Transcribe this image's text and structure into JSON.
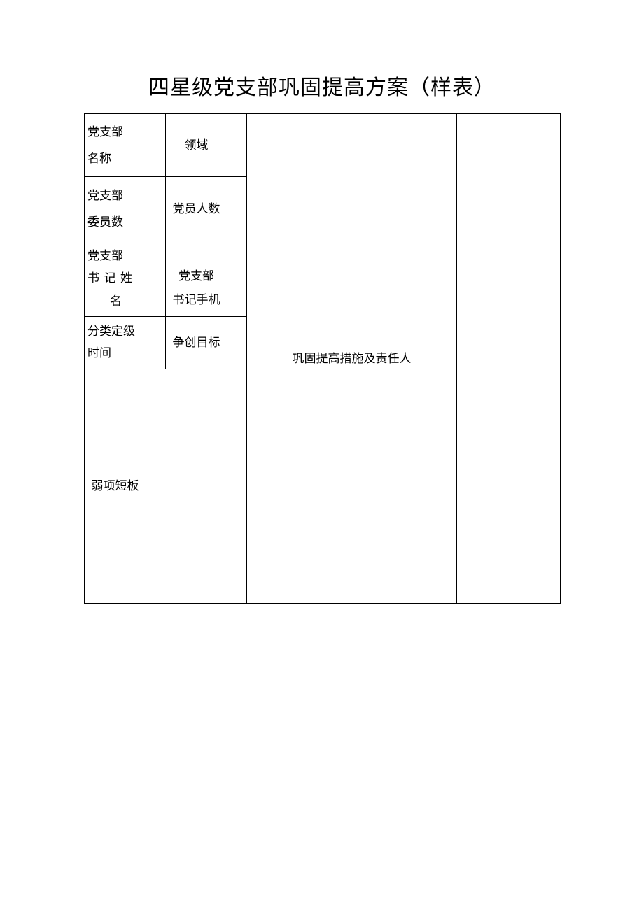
{
  "title": "四星级党支部巩固提高方案（样表）",
  "rows": {
    "r1": {
      "label_a": "党支部\n名称",
      "label_c": "领域"
    },
    "r2": {
      "label_a": "党支部\n委员数",
      "label_c": "党员人数"
    },
    "r3": {
      "label_a": "党支部\n书记姓\n名",
      "label_c": "党支部\n书记手机"
    },
    "r4": {
      "label_a": "分类定级\n时间",
      "label_c": "争创目标"
    },
    "r5": {
      "label_a": "弱项短板"
    }
  },
  "merged": {
    "label": "巩固提高措施及责任人"
  }
}
